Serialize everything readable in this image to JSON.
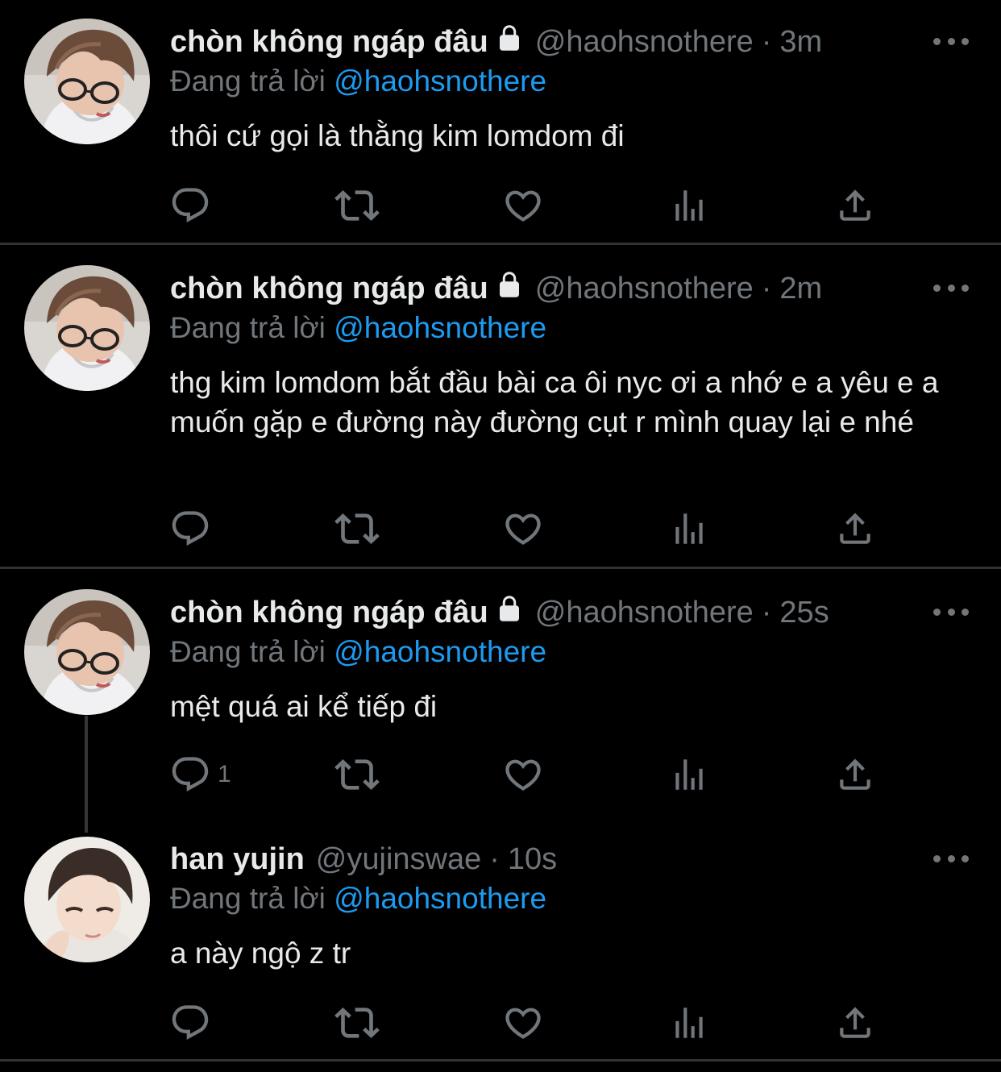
{
  "colors": {
    "background": "#000000",
    "text": "#e7e9ea",
    "muted": "#71767b",
    "link": "#1d9bf0",
    "divider": "#2f3336"
  },
  "replying_prefix": "Đang trả lời",
  "tweets": [
    {
      "name": "chòn không ngáp đâu",
      "locked": true,
      "handle": "@haohsnothere",
      "time": "3m",
      "reply_to": "@haohsnothere",
      "text": "thôi cứ gọi là thằng kim lomdom đi",
      "reply_count": "",
      "icons": [
        "reply-icon",
        "retweet-icon",
        "like-icon",
        "analytics-icon",
        "share-icon"
      ]
    },
    {
      "name": "chòn không ngáp đâu",
      "locked": true,
      "handle": "@haohsnothere",
      "time": "2m",
      "reply_to": "@haohsnothere",
      "text": "thg kim lomdom bắt đầu bài ca ôi nyc ơi a nhớ e a yêu e a muốn gặp e đường này đường cụt r mình quay lại e nhé",
      "reply_count": "",
      "icons": [
        "reply-icon",
        "retweet-icon",
        "like-icon",
        "analytics-icon",
        "share-icon"
      ]
    },
    {
      "name": "chòn không ngáp đâu",
      "locked": true,
      "handle": "@haohsnothere",
      "time": "25s",
      "reply_to": "@haohsnothere",
      "text": "mệt quá ai kể tiếp đi",
      "reply_count": "1",
      "icons": [
        "reply-icon",
        "retweet-icon",
        "like-icon",
        "analytics-icon",
        "share-icon"
      ]
    },
    {
      "name": "han yujin",
      "locked": false,
      "handle": "@yujinswae",
      "time": "10s",
      "reply_to": "@haohsnothere",
      "text": "a này ngộ z tr",
      "reply_count": "",
      "icons": [
        "reply-icon",
        "retweet-icon",
        "like-icon",
        "analytics-icon",
        "share-icon"
      ]
    }
  ],
  "separator": "·"
}
